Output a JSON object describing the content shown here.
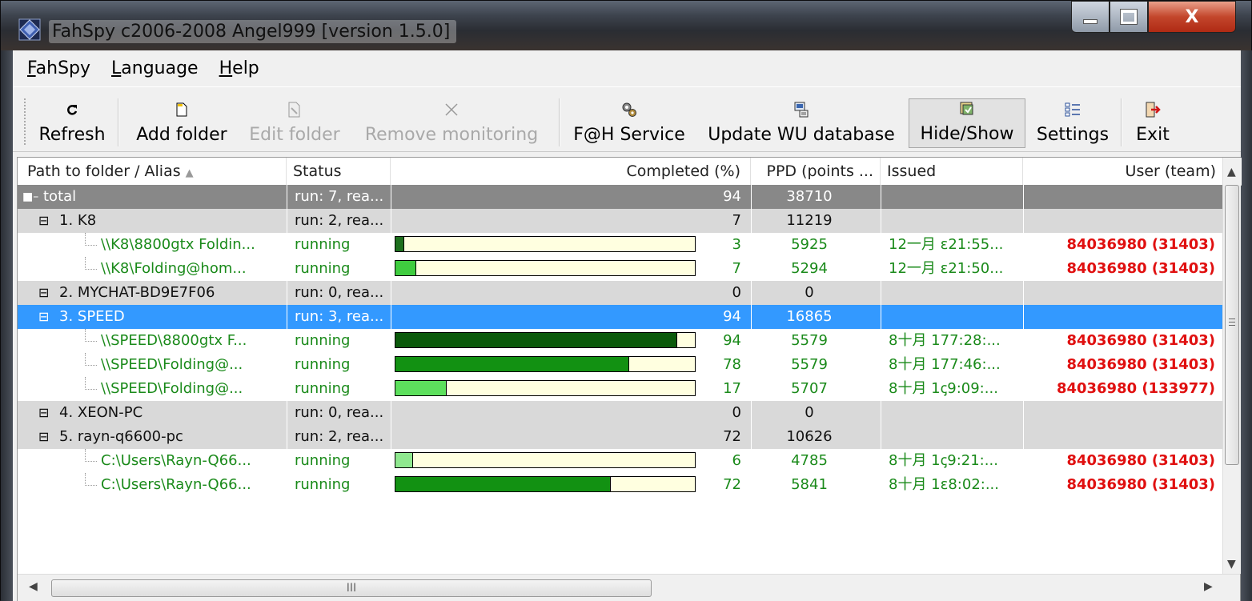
{
  "window": {
    "title": "FahSpy c2006-2008 Angel999 [version 1.5.0]",
    "close_glyph": "X"
  },
  "menu": [
    {
      "first": "F",
      "rest": "ahSpy"
    },
    {
      "first": "L",
      "rest": "anguage"
    },
    {
      "first": "H",
      "rest": "elp"
    }
  ],
  "toolbar": {
    "refresh": "Refresh",
    "add_folder": "Add folder",
    "edit_folder": "Edit folder",
    "remove_monitoring": "Remove monitoring",
    "fah_service": "F@H Service",
    "update_wu": "Update WU database",
    "hide_show": "Hide/Show",
    "settings": "Settings",
    "exit": "Exit"
  },
  "columns": {
    "path": "Path to folder / Alias",
    "status": "Status",
    "completed": "Completed (%)",
    "ppd": "PPD (points ...",
    "issued": "Issued",
    "user": "User (team)",
    "extra": "("
  },
  "rows": [
    {
      "kind": "total",
      "path": "total",
      "status": "run: 7, rea...",
      "completed": "94",
      "ppd": "38710",
      "issued": "",
      "user": ""
    },
    {
      "kind": "group",
      "path": "1. K8",
      "status": "run: 2, rea...",
      "completed": "7",
      "ppd": "11219",
      "issued": "",
      "user": ""
    },
    {
      "kind": "item",
      "path": "\\\\K8\\8800gtx Foldin...",
      "status": "running",
      "progress": 3,
      "completed": "3",
      "ppd": "5925",
      "issued": "12一月 ɛ21:55...",
      "user": "84036980 (31403)",
      "fill": "#1d6f1d"
    },
    {
      "kind": "item",
      "path": "\\\\K8\\Folding@hom...",
      "status": "running",
      "progress": 7,
      "completed": "7",
      "ppd": "5294",
      "issued": "12一月 ɛ21:50...",
      "user": "84036980 (31403)",
      "fill": "#3fcc3f"
    },
    {
      "kind": "group",
      "path": "2. MYCHAT-BD9E7F06",
      "status": "run: 0, rea...",
      "completed": "0",
      "ppd": "0",
      "issued": "",
      "user": ""
    },
    {
      "kind": "sel",
      "path": "3. SPEED",
      "status": "run: 3, rea...",
      "completed": "94",
      "ppd": "16865",
      "issued": "",
      "user": ""
    },
    {
      "kind": "item",
      "path": "\\\\SPEED\\8800gtx F...",
      "status": "running",
      "progress": 94,
      "completed": "94",
      "ppd": "5579",
      "issued": "8十月 177:28:...",
      "user": "84036980 (31403)",
      "fill": "#0b5a0b"
    },
    {
      "kind": "item",
      "path": "\\\\SPEED\\Folding@...",
      "status": "running",
      "progress": 78,
      "completed": "78",
      "ppd": "5579",
      "issued": "8十月 177:46:...",
      "user": "84036980 (31403)",
      "fill": "#129112"
    },
    {
      "kind": "item",
      "path": "\\\\SPEED\\Folding@...",
      "status": "running",
      "progress": 17,
      "completed": "17",
      "ppd": "5707",
      "issued": "8十月 1ꞔ9:09:...",
      "user": "84036980 (133977)",
      "fill": "#5de05d"
    },
    {
      "kind": "group",
      "path": "4. XEON-PC",
      "status": "run: 0, rea...",
      "completed": "0",
      "ppd": "0",
      "issued": "",
      "user": ""
    },
    {
      "kind": "group",
      "path": "5. rayn-q6600-pc",
      "status": "run: 2, rea...",
      "completed": "72",
      "ppd": "10626",
      "issued": "",
      "user": ""
    },
    {
      "kind": "item",
      "path": "C:\\Users\\Rayn-Q66...",
      "status": "running",
      "progress": 6,
      "completed": "6",
      "ppd": "4785",
      "issued": "8十月 1ꞔ9:21:...",
      "user": "84036980 (31403)",
      "fill": "#8fe88f"
    },
    {
      "kind": "item",
      "path": "C:\\Users\\Rayn-Q66...",
      "status": "running",
      "progress": 72,
      "completed": "72",
      "ppd": "5841",
      "issued": "8十月 1ɛ8:02:...",
      "user": "84036980 (31403)",
      "fill": "#129112"
    }
  ],
  "scroll": {
    "hthumb_label": "III"
  }
}
